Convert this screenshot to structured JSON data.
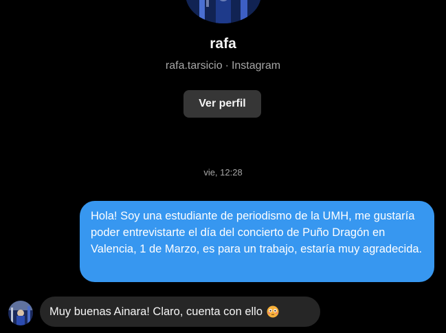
{
  "profile": {
    "name": "rafa",
    "username": "rafa.tarsicio",
    "separator": "·",
    "platform": "Instagram",
    "view_profile_label": "Ver perfil"
  },
  "thread": {
    "timestamp": "vie, 12:28",
    "messages": [
      {
        "direction": "sent",
        "text": "Hola! Soy una estudiante de periodismo de la UMH, me gustaría poder entrevistarte el día del concierto de Puño Dragón en Valencia, 1 de Marzo, es para un trabajo, estaría muy agradecida."
      },
      {
        "direction": "received",
        "text": "Muy buenas Ainara! Claro, cuenta con ello",
        "emoji": "flushed-face"
      }
    ]
  },
  "colors": {
    "background": "#000000",
    "sent_bubble": "#3797f0",
    "received_bubble": "#262626",
    "button": "#363636",
    "secondary_text": "#a8a8a8"
  }
}
